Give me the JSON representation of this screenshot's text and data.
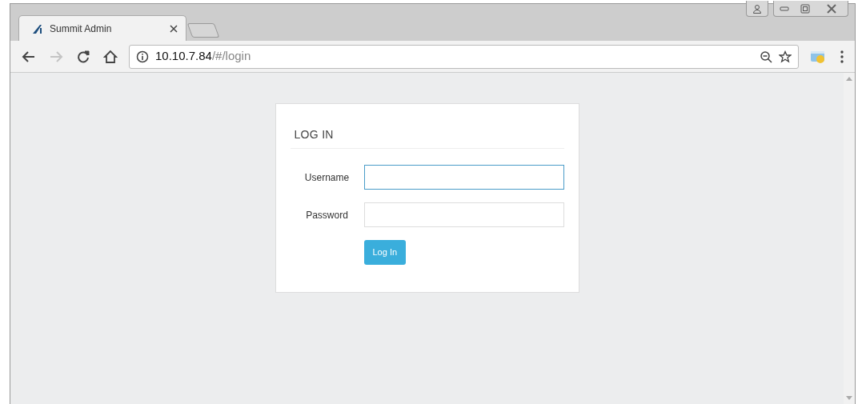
{
  "browser": {
    "tabs": [
      {
        "title": "Summit Admin",
        "selected": true
      }
    ],
    "nav": [
      {
        "kind": "back",
        "disabled": false
      },
      {
        "kind": "forward",
        "disabled": true
      },
      {
        "kind": "reload",
        "disabled": false
      },
      {
        "kind": "home",
        "disabled": false
      }
    ],
    "address": {
      "host": "10.10.7.84",
      "path": "/#/login"
    }
  },
  "login": {
    "heading": "LOG IN",
    "fields": [
      {
        "label": "Username",
        "focused": true
      },
      {
        "label": "Password",
        "focused": false
      }
    ],
    "button": "Log In"
  }
}
